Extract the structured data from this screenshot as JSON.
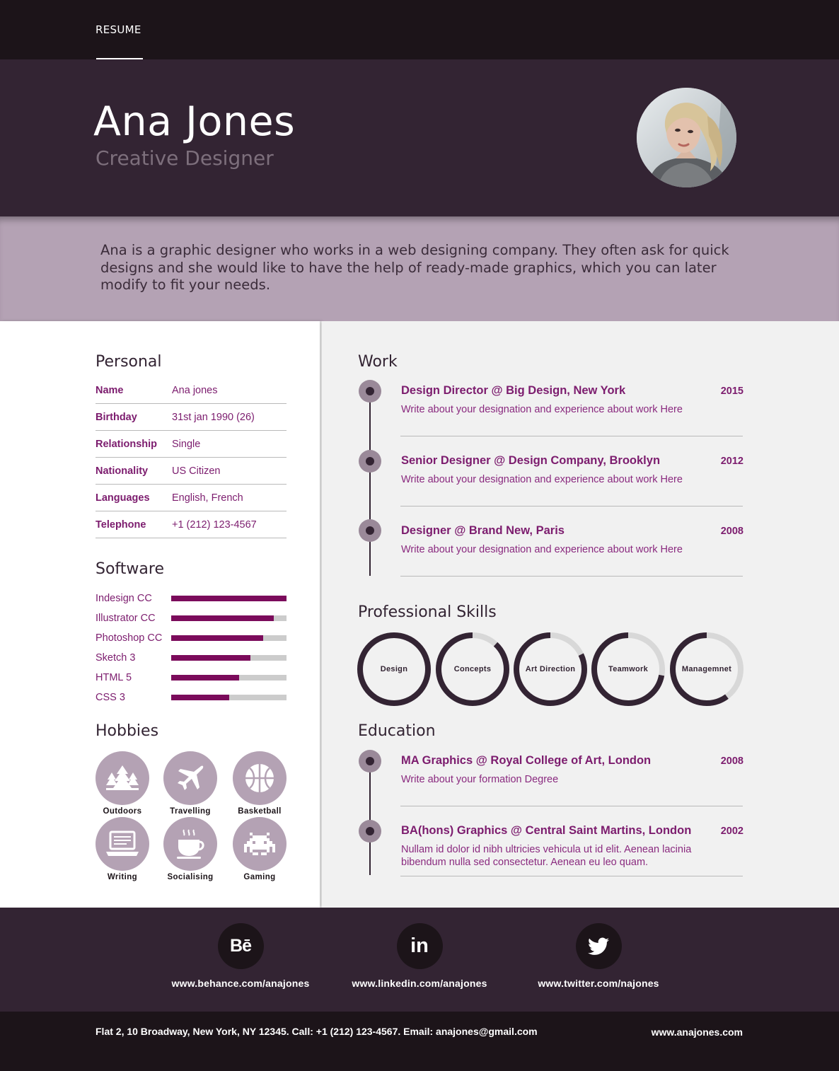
{
  "nav": {
    "item": "RESUME"
  },
  "header": {
    "name": "Ana Jones",
    "role": "Creative Designer"
  },
  "summary": "Ana is a graphic designer who works in a web designing company. They often ask for quick designs and she would like to have the help of ready-made graphics, which you can later modify  to fit  your needs.",
  "personal": {
    "title": "Personal",
    "rows": [
      {
        "key": "Name",
        "value": "Ana jones"
      },
      {
        "key": "Birthday",
        "value": "31st jan 1990 (26)"
      },
      {
        "key": "Relationship",
        "value": "Single"
      },
      {
        "key": "Nationality",
        "value": "US Citizen"
      },
      {
        "key": "Languages",
        "value": "English, French"
      },
      {
        "key": "Telephone",
        "value": "+1 (212) 123-4567"
      }
    ]
  },
  "software": {
    "title": "Software",
    "items": [
      {
        "name": "Indesign CC",
        "level": 1.0
      },
      {
        "name": "Illustrator CC",
        "level": 0.89
      },
      {
        "name": "Photoshop CC",
        "level": 0.8
      },
      {
        "name": "Sketch 3",
        "level": 0.69
      },
      {
        "name": "HTML 5",
        "level": 0.59
      },
      {
        "name": "CSS 3",
        "level": 0.5
      }
    ]
  },
  "hobbies": {
    "title": "Hobbies",
    "items": [
      {
        "label": "Outdoors",
        "icon": "trees-icon"
      },
      {
        "label": "Travelling",
        "icon": "airplane-icon"
      },
      {
        "label": "Basketball",
        "icon": "basketball-icon"
      },
      {
        "label": "Writing",
        "icon": "laptop-icon"
      },
      {
        "label": "Socialising",
        "icon": "coffee-cup-icon"
      },
      {
        "label": "Gaming",
        "icon": "space-invader-icon"
      }
    ]
  },
  "work": {
    "title": "Work",
    "items": [
      {
        "title": "Design Director @ Big Design, New York",
        "year": "2015",
        "desc": "Write about your designation and experience about work Here"
      },
      {
        "title": "Senior Designer @ Design Company, Brooklyn",
        "year": "2012",
        "desc": "Write about your designation and experience about work Here"
      },
      {
        "title": "Designer @ Brand New, Paris",
        "year": "2008",
        "desc": "Write about your designation and experience about work Here"
      }
    ]
  },
  "skills": {
    "title": "Professional Skills",
    "items": [
      {
        "label": "Design",
        "level": 1.0
      },
      {
        "label": "Concepts",
        "level": 0.88
      },
      {
        "label": "Art Direction",
        "level": 0.82
      },
      {
        "label": "Teamwork",
        "level": 0.72
      },
      {
        "label": "Managemnet",
        "level": 0.6
      }
    ]
  },
  "education": {
    "title": "Education",
    "items": [
      {
        "title": "MA Graphics @ Royal College of Art, London",
        "year": "2008",
        "desc": "Write about your formation Degree"
      },
      {
        "title": "BA(hons) Graphics @ Central Saint Martins, London",
        "year": "2002",
        "desc": "Nullam id dolor id nibh ultricies vehicula ut id elit. Aenean lacinia bibendum nulla sed consectetur. Aenean eu leo quam."
      }
    ]
  },
  "social": [
    {
      "icon": "behance-icon",
      "glyph": "Bē",
      "url": "www.behance.com/anajones"
    },
    {
      "icon": "linkedin-icon",
      "glyph": "in",
      "url": "www.linkedin.com/anajones"
    },
    {
      "icon": "twitter-icon",
      "glyph": "",
      "url": "www.twitter.com/najones"
    }
  ],
  "footer": {
    "address": "Flat 2, 10 Broadway, New York, NY 12345. Call: +1 (212) 123-4567. Email: anajones@gmail.com",
    "website": "www.anajones.com"
  },
  "colors": {
    "dark": "#1c1419",
    "header": "#332433",
    "lilac": "#b4a2b4",
    "accent": "#7c1c6e",
    "bar": "#7b0b5b"
  }
}
